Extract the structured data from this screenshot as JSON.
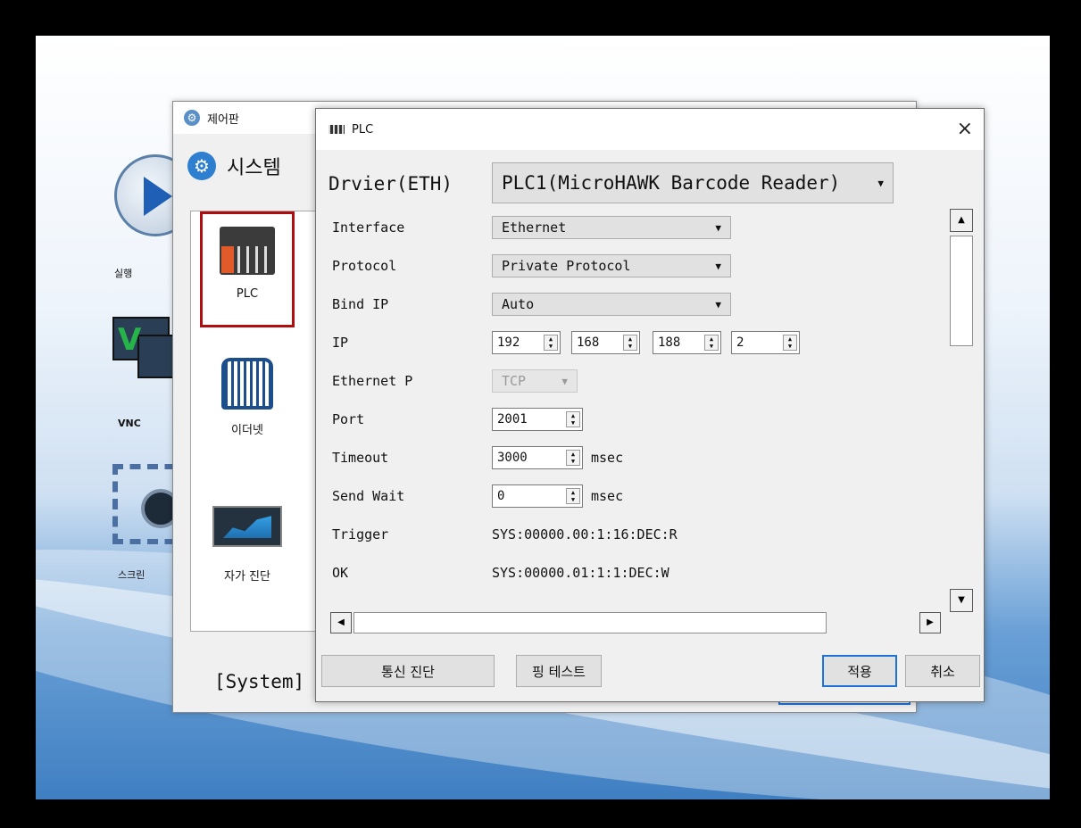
{
  "desktop": {
    "icon_labels": [
      "실행",
      "VNC",
      "스크린"
    ]
  },
  "control_panel": {
    "title": "제어판",
    "header": "시스템",
    "items": [
      {
        "label": "PLC"
      },
      {
        "label": "이더넷"
      },
      {
        "label": "자가 진단"
      }
    ],
    "bottom_label": "[System]"
  },
  "plc_dialog": {
    "title": "PLC",
    "close": "×",
    "driver": {
      "label": "Drvier(ETH)",
      "value": "PLC1(MicroHAWK Barcode Reader)"
    },
    "fields": {
      "interface": {
        "label": "Interface",
        "value": "Ethernet"
      },
      "protocol": {
        "label": "Protocol",
        "value": "Private Protocol"
      },
      "bind_ip": {
        "label": "Bind IP",
        "value": "Auto"
      },
      "ip": {
        "label": "IP",
        "octets": [
          "192",
          "168",
          "188",
          "2"
        ]
      },
      "ethernet_p": {
        "label": "Ethernet P",
        "value": "TCP"
      },
      "port": {
        "label": "Port",
        "value": "2001"
      },
      "timeout": {
        "label": "Timeout",
        "value": "3000",
        "unit": "msec"
      },
      "send_wait": {
        "label": "Send Wait",
        "value": "0",
        "unit": "msec"
      },
      "trigger": {
        "label": "Trigger",
        "value": "SYS:00000.00:1:16:DEC:R"
      },
      "ok": {
        "label": "OK",
        "value": "SYS:00000.01:1:1:DEC:W"
      }
    },
    "buttons": {
      "comm_diag": "통신 진단",
      "ping_test": "핑 테스트",
      "apply": "적용",
      "cancel": "취소"
    }
  }
}
